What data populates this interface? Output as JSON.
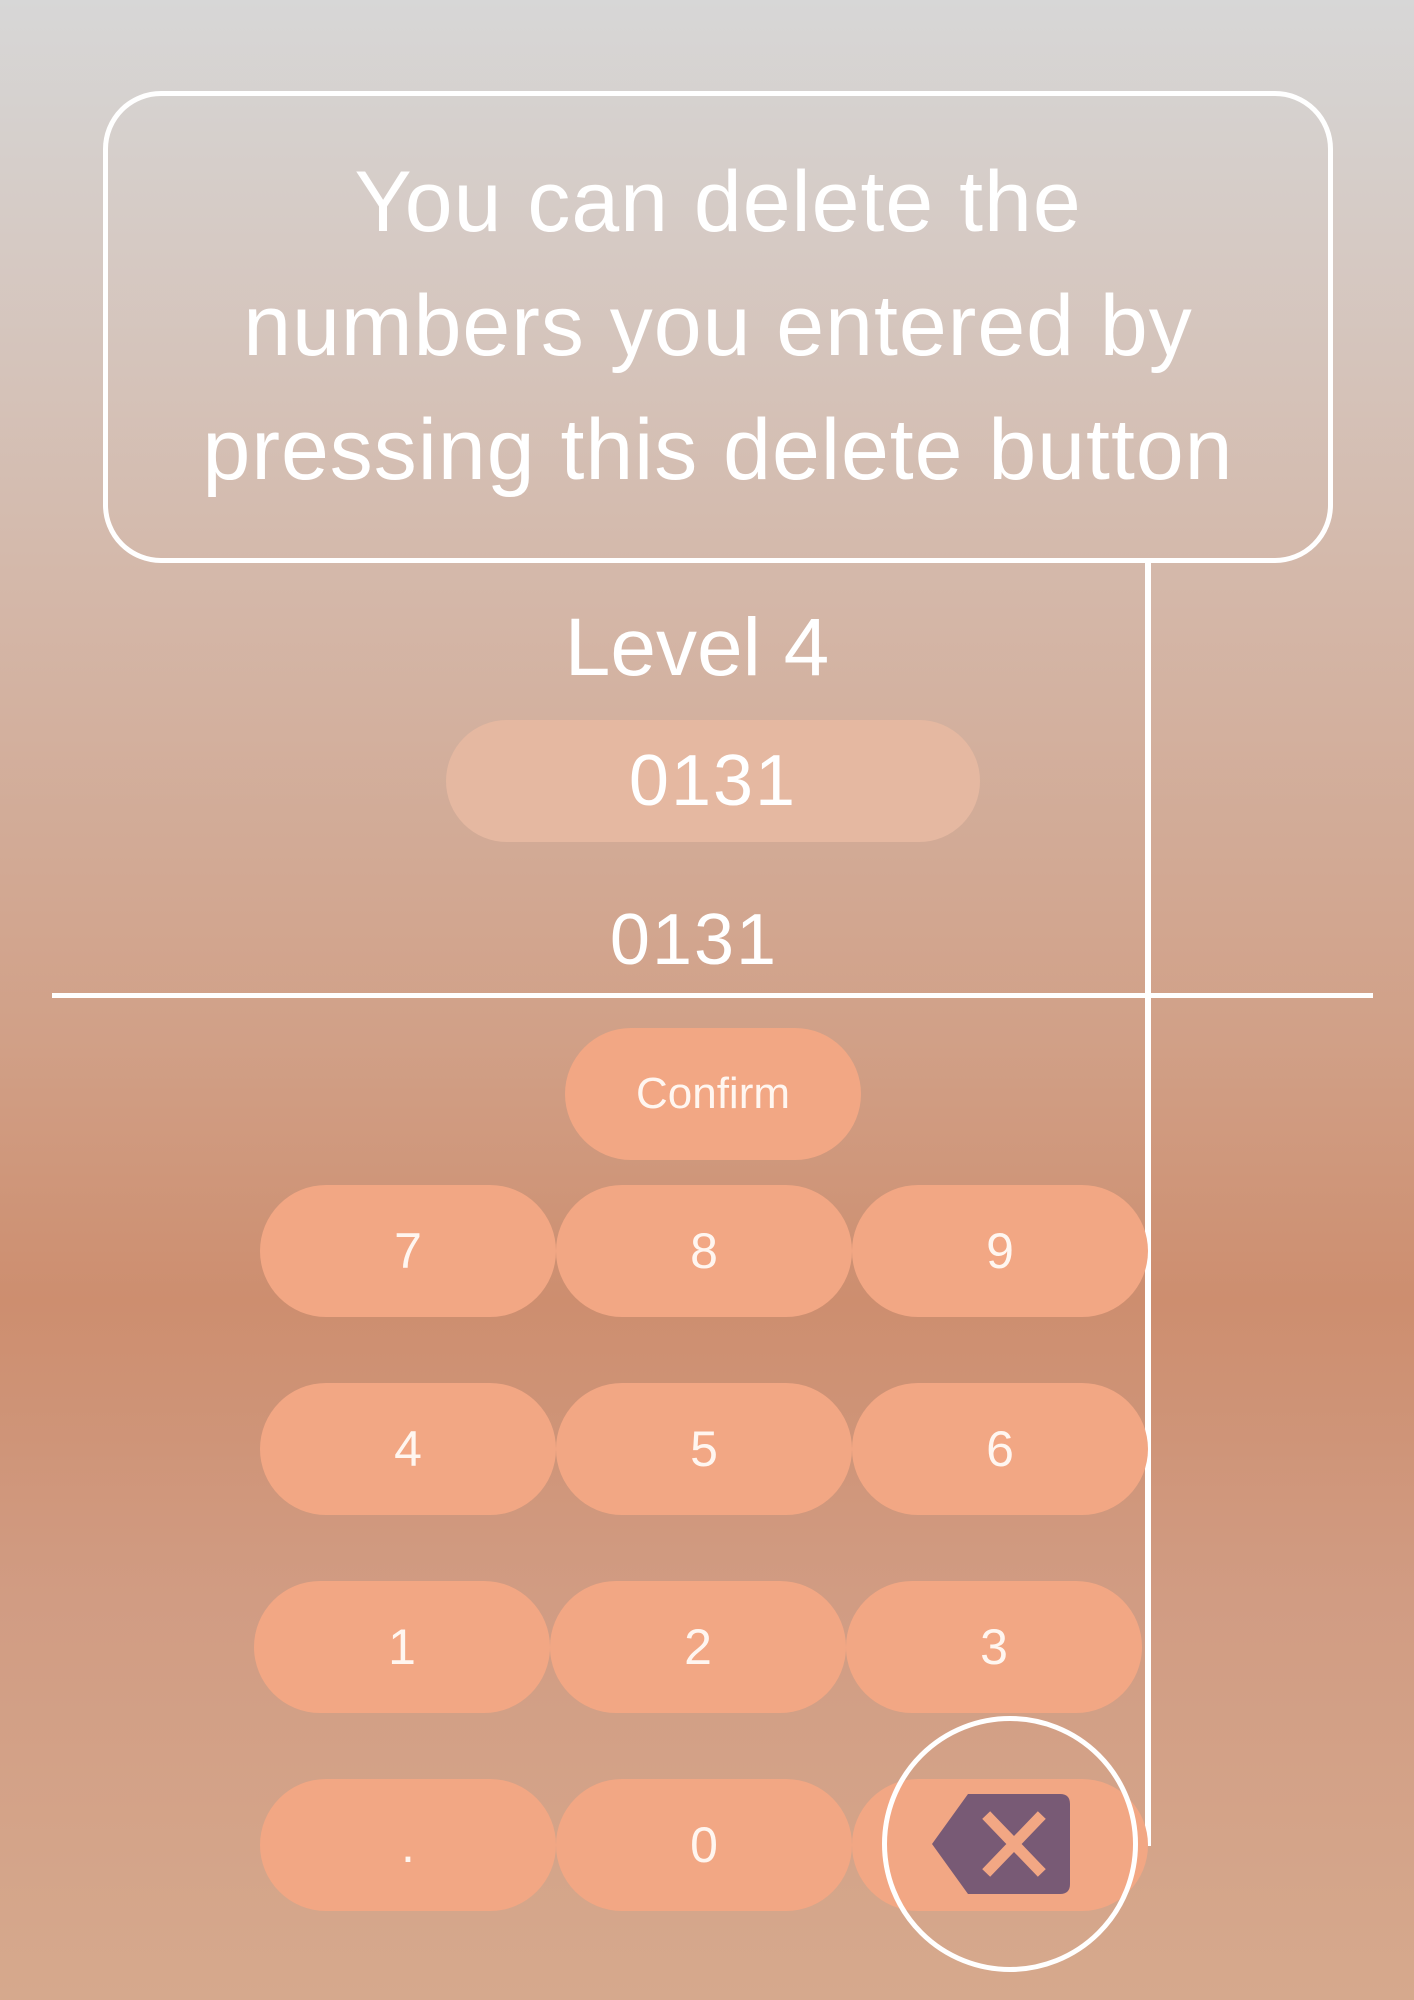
{
  "tooltip": {
    "line1": "You can delete the",
    "line2": "numbers you entered by",
    "line3": "pressing this delete button"
  },
  "level": {
    "title": "Level 4"
  },
  "display": {
    "value": "0131",
    "echo": "0131"
  },
  "buttons": {
    "confirm": "Confirm"
  },
  "keypad": {
    "k7": "7",
    "k8": "8",
    "k9": "9",
    "k4": "4",
    "k5": "5",
    "k6": "6",
    "k1": "1",
    "k2": "2",
    "k3": "3",
    "dot": ".",
    "k0": "0",
    "delete_icon": "backspace-icon"
  },
  "colors": {
    "key_fill": "#f2a784",
    "display_fill": "#e5b8a1",
    "delete_icon_fill": "#785a75",
    "delete_icon_cross": "#f2a784",
    "highlight": "#ffffff"
  }
}
